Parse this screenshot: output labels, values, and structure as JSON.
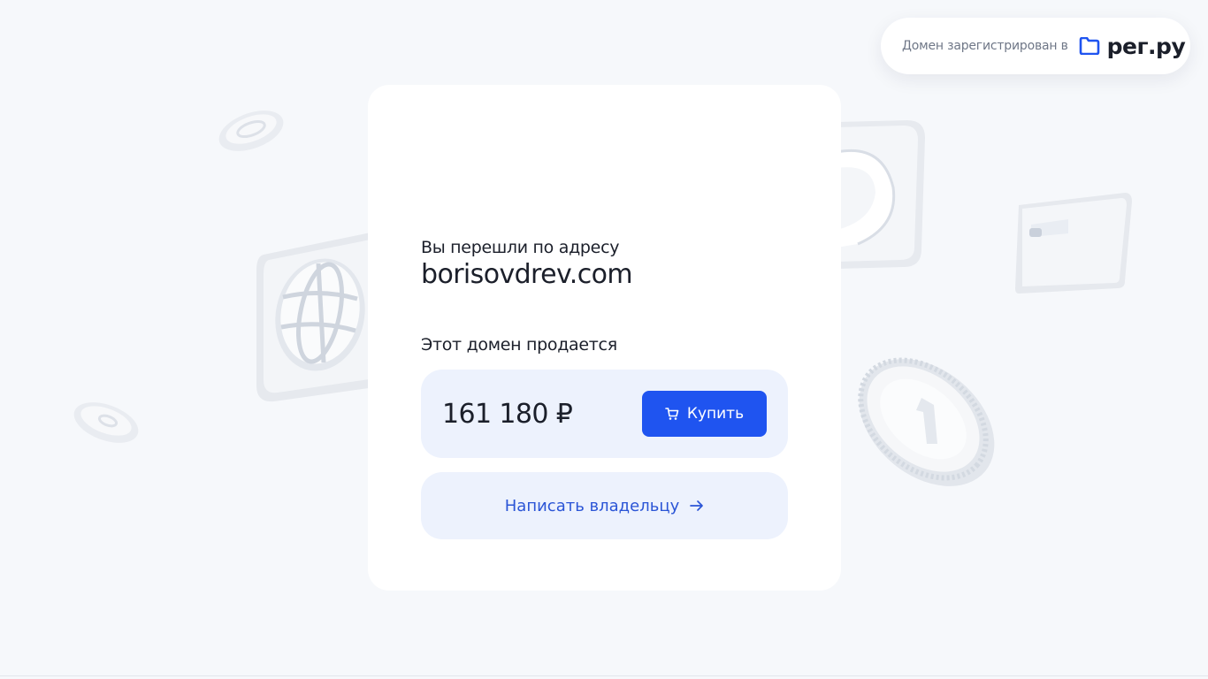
{
  "registrar": {
    "text": "Домен зарегистрирован в",
    "brand": "рег.ру",
    "brand_icon": "folder-icon",
    "brand_color": "#1f54f0"
  },
  "card": {
    "subtitle": "Вы перешли по адресу",
    "domain": "borisovdrev.com",
    "sale_label": "Этот домен продается",
    "price": "161 180 ₽",
    "buy_label": "Купить",
    "buy_icon": "cart-icon",
    "contact_label": "Написать владельцу",
    "contact_icon": "arrow-right-icon"
  },
  "colors": {
    "accent": "#1f54f0",
    "link": "#2b55d6",
    "soft_blue": "#edf2fd",
    "background": "#f6f8fb"
  }
}
